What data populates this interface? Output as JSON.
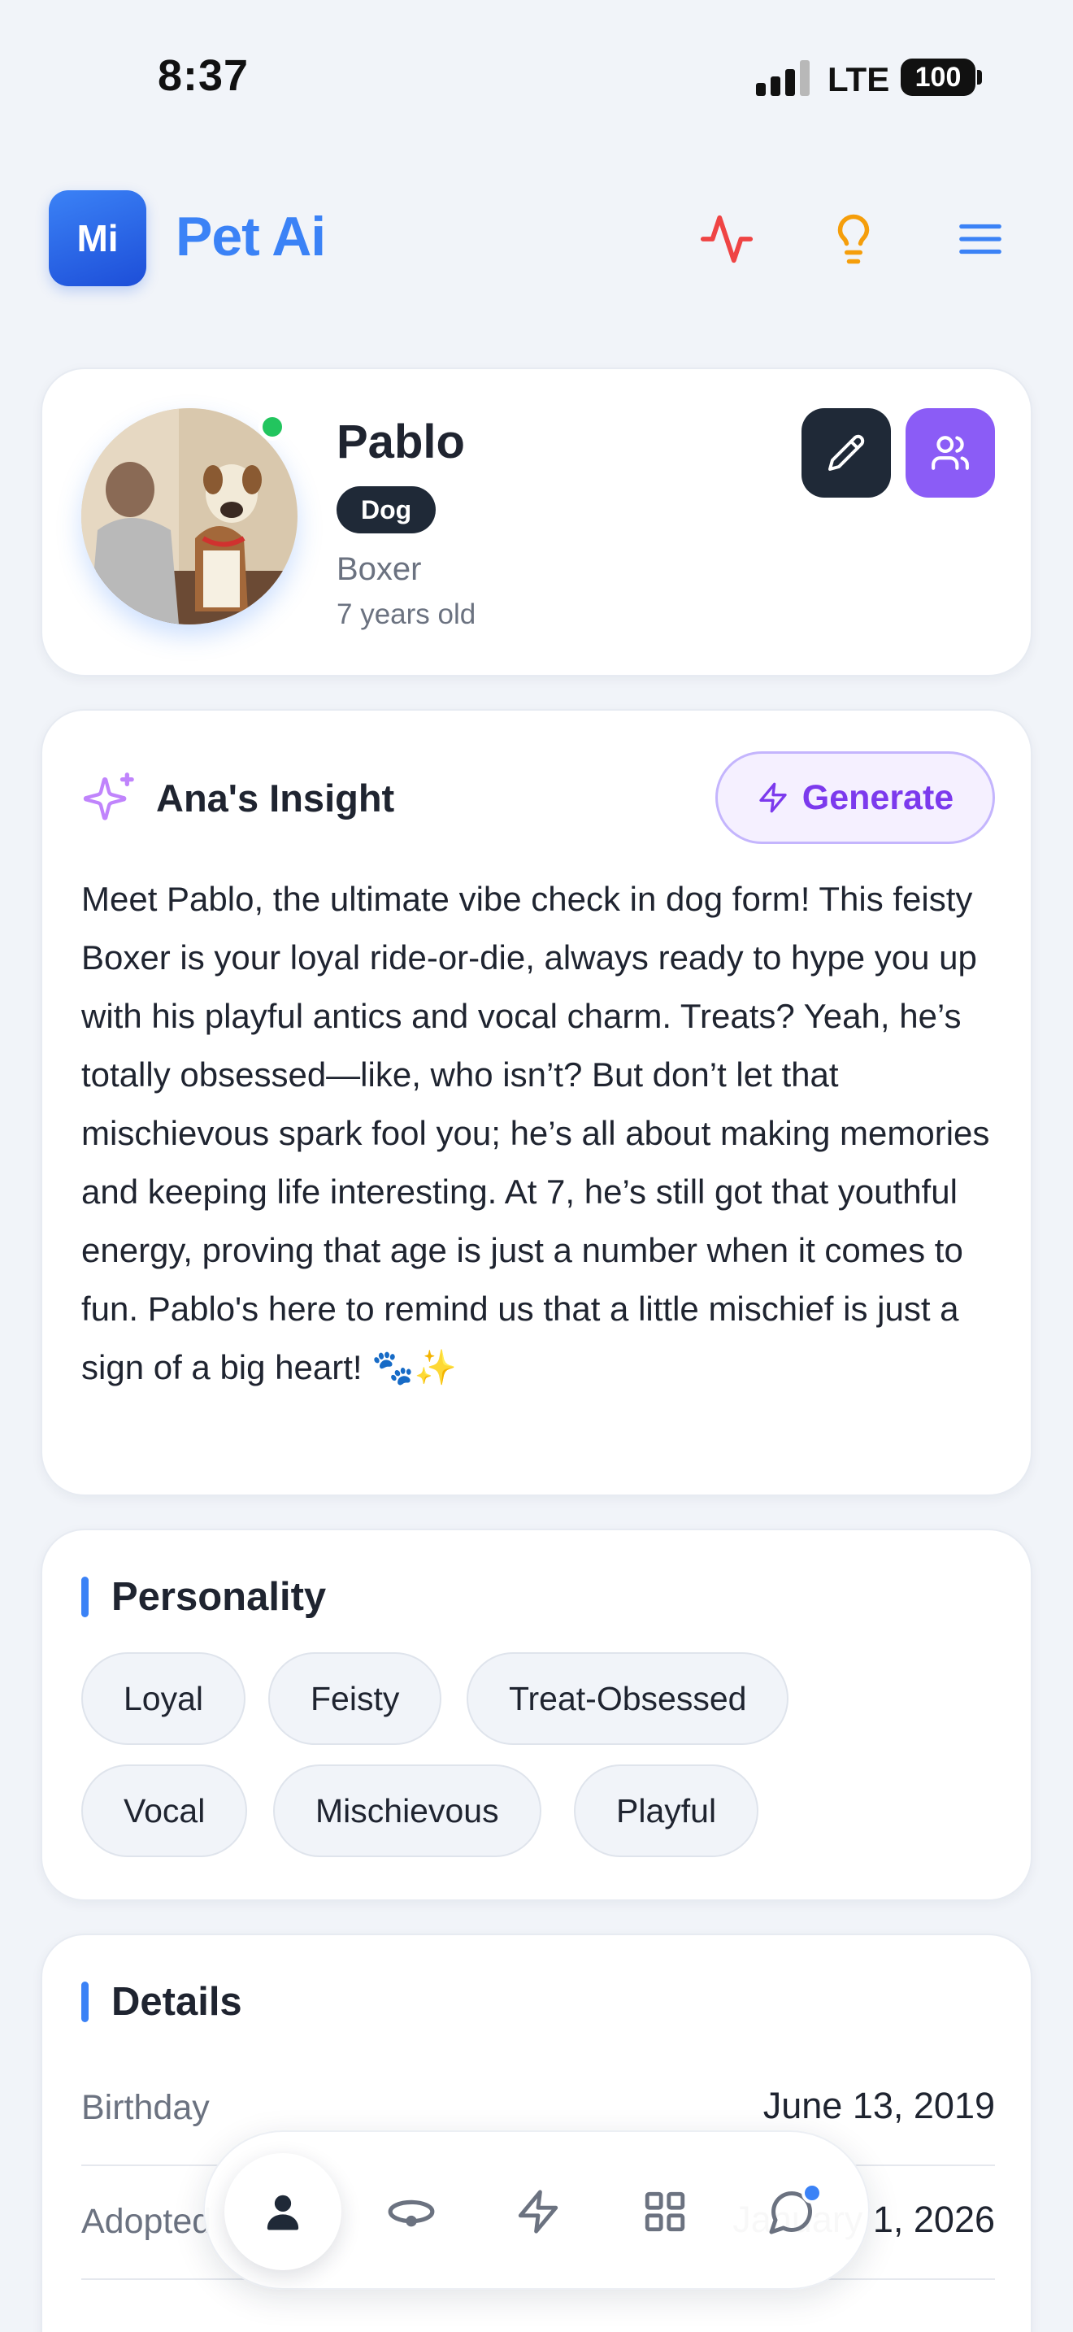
{
  "status_bar": {
    "time": "8:37",
    "network": "LTE",
    "battery": "100"
  },
  "header": {
    "logo_text": "Mi",
    "app_title": "Pet Ai",
    "icons": [
      "activity-icon",
      "lightbulb-icon",
      "menu-icon"
    ]
  },
  "profile": {
    "name": "Pablo",
    "species": "Dog",
    "breed": "Boxer",
    "age": "7 years old",
    "online": true
  },
  "insight": {
    "title": "Ana's Insight",
    "generate_label": "Generate",
    "text": "Meet Pablo, the ultimate vibe check in dog form! This feisty Boxer is your loyal ride-or-die, always ready to hype you up with his playful antics and vocal charm. Treats? Yeah, he’s totally obsessed—like, who isn’t? But don’t let that mischievous spark fool you; he’s all about making memories and keeping life interesting. At 7, he’s still got that youthful energy, proving that age is just a number when it comes to fun. Pablo's here to remind us that a little mischief is just a sign of a big heart! 🐾✨"
  },
  "personality": {
    "title": "Personality",
    "tags": [
      "Loyal",
      "Feisty",
      "Treat-Obsessed",
      "Vocal",
      "Mischievous",
      "Playful"
    ]
  },
  "details": {
    "title": "Details",
    "rows": [
      {
        "label": "Birthday",
        "value": "June 13, 2019"
      },
      {
        "label": "Adopted",
        "value": "January 1, 2026"
      }
    ]
  },
  "bottom_nav": {
    "items": [
      "profile-icon",
      "collar-icon",
      "lightning-icon",
      "grid-icon",
      "chat-icon"
    ],
    "active": "profile-icon",
    "chat_has_notification": true
  },
  "colors": {
    "primary": "#3b82f6",
    "purple": "#8b5cf6",
    "dark": "#1f2937",
    "online": "#22c55e",
    "activity": "#ef4444",
    "lightbulb": "#f59e0b"
  }
}
